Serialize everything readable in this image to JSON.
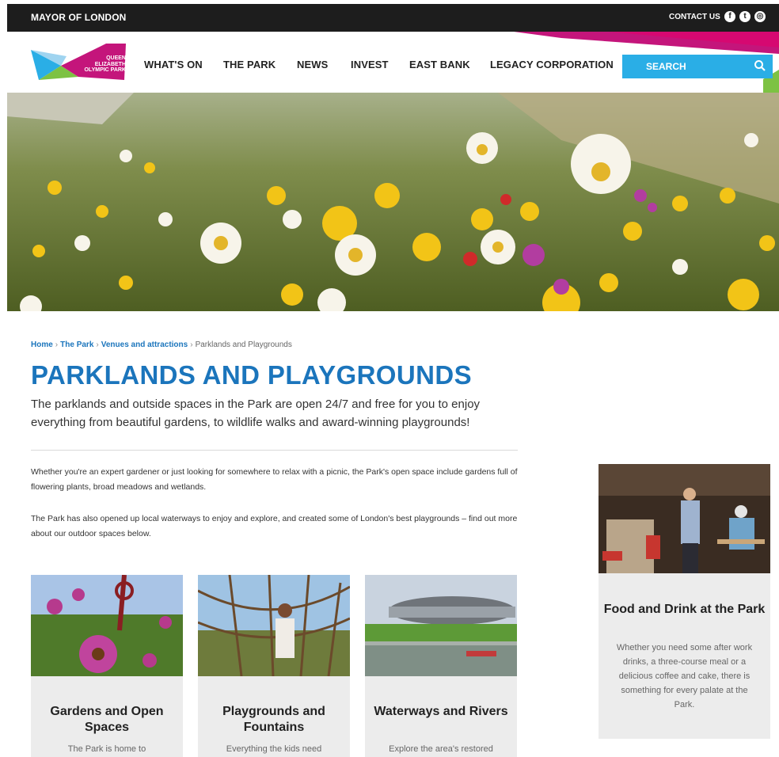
{
  "topbar": {
    "brand": "MAYOR OF LONDON",
    "contact_label": "CONTACT US",
    "social": [
      {
        "name": "facebook-icon",
        "glyph": "f"
      },
      {
        "name": "twitter-icon",
        "glyph": "t"
      },
      {
        "name": "instagram-icon",
        "glyph": "◎"
      }
    ]
  },
  "logo": {
    "line1": "QUEEN",
    "line2": "ELIZABETH",
    "line3": "OLYMPIC PARK"
  },
  "nav": {
    "items": [
      "WHAT'S ON",
      "THE PARK",
      "NEWS",
      "INVEST",
      "EAST BANK",
      "LEGACY CORPORATION"
    ],
    "search_label": "SEARCH"
  },
  "breadcrumb": {
    "items": [
      "Home",
      "The Park",
      "Venues and attractions"
    ],
    "current": "Parklands and Playgrounds"
  },
  "page": {
    "title": "PARKLANDS AND PLAYGROUNDS",
    "intro": "The parklands and outside spaces in the Park are open 24/7 and free for you to enjoy everything from beautiful gardens, to wildlife walks and award-winning playgrounds!",
    "paragraphs": [
      "Whether you're an expert gardener or just looking for somewhere to relax with a picnic, the Park's open space include gardens full of flowering plants, broad meadows and wetlands.",
      "The Park has also opened up local waterways to enjoy and explore, and created some of London's best playgrounds – find out more about our outdoor spaces below."
    ]
  },
  "cards": [
    {
      "title": "Gardens and Open Spaces",
      "text": "The Park is home to"
    },
    {
      "title": "Playgrounds and Fountains",
      "text": "Everything the kids need"
    },
    {
      "title": "Waterways and Rivers",
      "text": "Explore the area's restored"
    }
  ],
  "side_card": {
    "title": "Food and Drink at the Park",
    "text": "Whether you need some after work drinks, a three-course meal or a delicious coffee and cake, there is something for every palate at the Park."
  },
  "colors": {
    "accent_blue": "#1b75bc",
    "search_blue": "#2aaee6",
    "magenta": "#c4157b",
    "green": "#7dc243",
    "topbar": "#1d1d1d",
    "card_bg": "#ececec"
  }
}
